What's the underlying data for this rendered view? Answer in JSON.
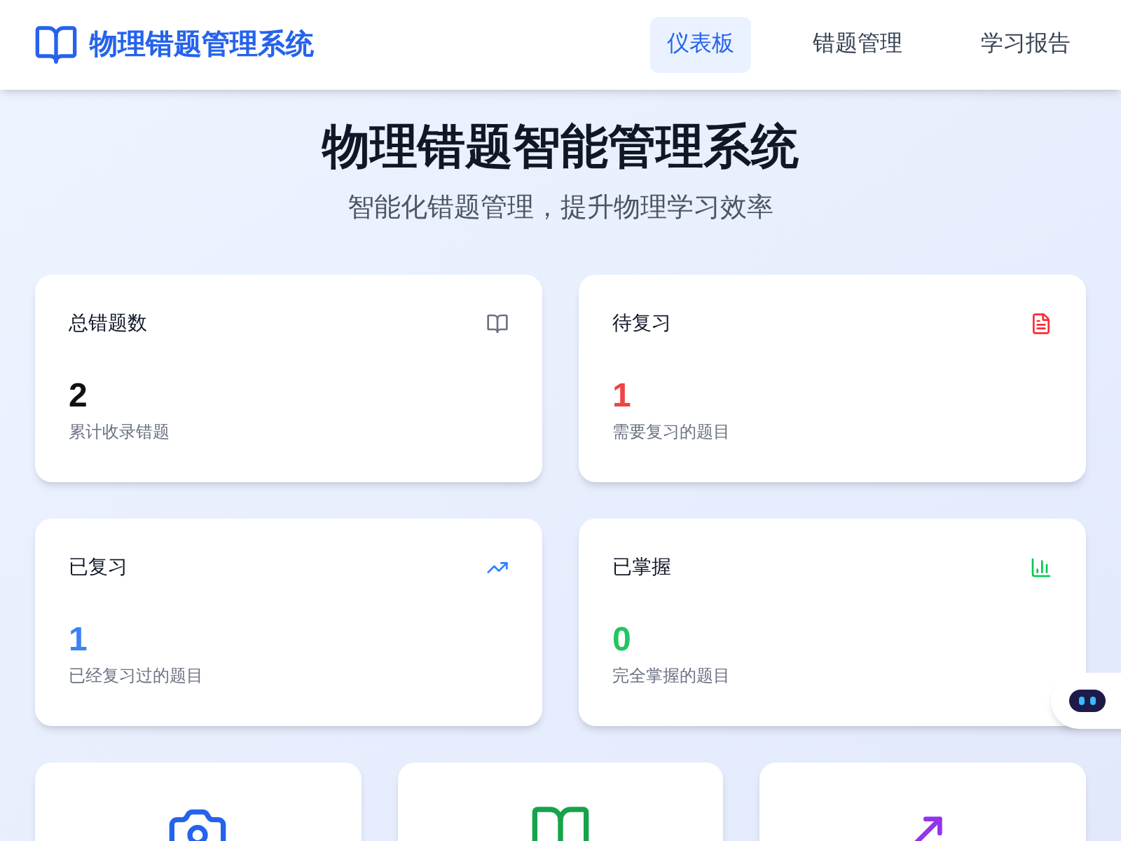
{
  "brand": {
    "title": "物理错题管理系统"
  },
  "nav": [
    {
      "label": "仪表板",
      "selected": true
    },
    {
      "label": "错题管理",
      "selected": false
    },
    {
      "label": "学习报告",
      "selected": false
    }
  ],
  "hero": {
    "title": "物理错题智能管理系统",
    "subtitle": "智能化错题管理，提升物理学习效率"
  },
  "stats": [
    {
      "label": "总错题数",
      "value": "2",
      "caption": "累计收录错题",
      "color": "#111111"
    },
    {
      "label": "待复习",
      "value": "1",
      "caption": "需要复习的题目",
      "color": "#ef4444"
    },
    {
      "label": "已复习",
      "value": "1",
      "caption": "已经复习过的题目",
      "color": "#3b82f6"
    },
    {
      "label": "已掌握",
      "value": "0",
      "caption": "完全掌握的题目",
      "color": "#22c55e"
    }
  ]
}
